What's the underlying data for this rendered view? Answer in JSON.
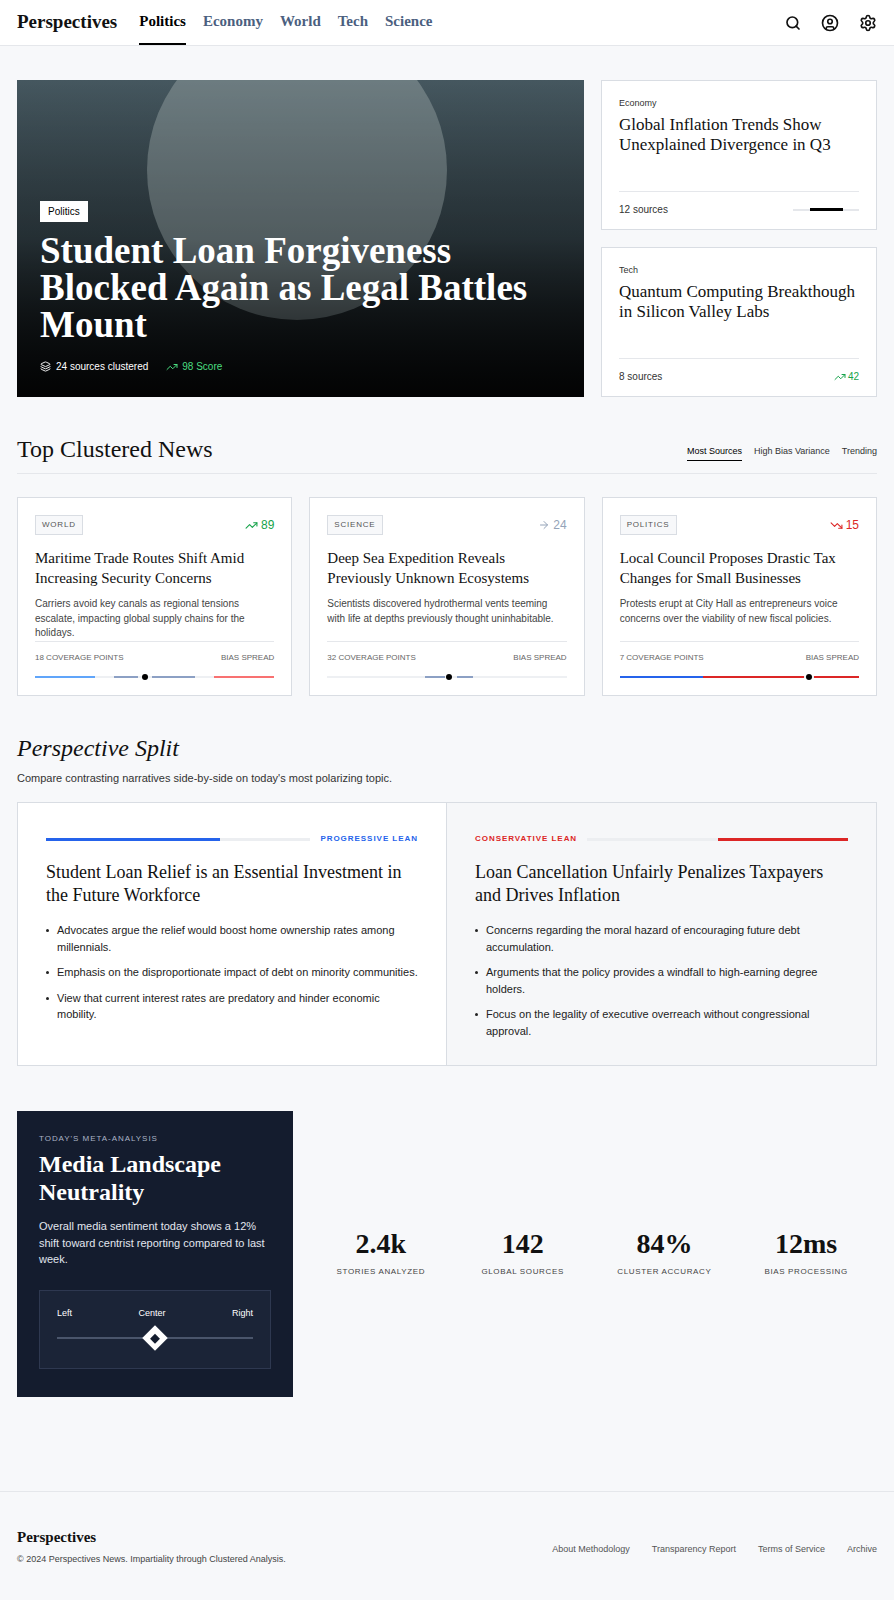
{
  "nav": {
    "logo": "Perspectives",
    "items": [
      {
        "label": "Politics",
        "selected": true
      },
      {
        "label": "Economy",
        "selected": false
      },
      {
        "label": "World",
        "selected": false
      },
      {
        "label": "Tech",
        "selected": false
      },
      {
        "label": "Science",
        "selected": false
      }
    ]
  },
  "hero": {
    "tag": "Politics",
    "title": "Student Loan Forgiveness Blocked Again as Legal Battles Mount",
    "sources": "24 sources clustered",
    "score": "98 Score"
  },
  "side_cards": [
    {
      "category": "Economy",
      "title": "Global Inflation Trends Show Unexplained Divergence in Q3",
      "sources": "12 sources",
      "kind": "spread",
      "start": 0.25,
      "end": 0.75
    },
    {
      "category": "Tech",
      "title": "Quantum Computing Breakthough in Silicon Valley Labs",
      "sources": "8 sources",
      "kind": "trend",
      "trend": "42"
    }
  ],
  "clustered": {
    "title": "Top Clustered News",
    "filters": [
      {
        "label": "Most Sources",
        "selected": true
      },
      {
        "label": "High Bias Variance",
        "selected": false
      },
      {
        "label": "Trending",
        "selected": false
      }
    ],
    "cards": [
      {
        "tag": "WORLD",
        "trend": "89",
        "direction": "up",
        "color": "#16a34a",
        "title": "Maritime Trade Routes Shift Amid Increasing Security Concerns",
        "summary": "Carriers avoid key canals as regional tensions escalate, impacting global supply chains for the holidays.",
        "coverage": "18 COVERAGE POINTS",
        "bias_label": "BIAS SPREAD",
        "marker": 0.46,
        "segments": [
          {
            "start": 0,
            "end": 0.25,
            "color": "#60a5fa"
          },
          {
            "start": 0.33,
            "end": 0.43,
            "color": "#8ca0c4"
          },
          {
            "start": 0.49,
            "end": 0.67,
            "color": "#8ca0c4"
          },
          {
            "start": 0.75,
            "end": 1,
            "color": "#f87171"
          }
        ]
      },
      {
        "tag": "SCIENCE",
        "trend": "24",
        "direction": "flat",
        "color": "#94a3b8",
        "title": "Deep Sea Expedition Reveals Previously Unknown Ecosystems",
        "summary": "Scientists discovered hydrothermal vents teeming with life at depths previously thought uninhabitable.",
        "coverage": "32 COVERAGE POINTS",
        "bias_label": "BIAS SPREAD",
        "marker": 0.51,
        "segments": [
          {
            "start": 0.41,
            "end": 0.49,
            "color": "#8ca0c4"
          },
          {
            "start": 0.54,
            "end": 0.61,
            "color": "#8ca0c4"
          }
        ]
      },
      {
        "tag": "POLITICS",
        "trend": "15",
        "direction": "down",
        "color": "#dc2626",
        "title": "Local Council Proposes Drastic Tax Changes for Small Businesses",
        "summary": "Protests erupt at City Hall as entrepreneurs voice concerns over the viability of new fiscal policies.",
        "coverage": "7 COVERAGE POINTS",
        "bias_label": "BIAS SPREAD",
        "marker": 0.79,
        "segments": [
          {
            "start": 0,
            "end": 0.35,
            "color": "#2563eb"
          },
          {
            "start": 0.35,
            "end": 0.77,
            "color": "#dc2626"
          },
          {
            "start": 0.81,
            "end": 1,
            "color": "#dc2626"
          }
        ]
      }
    ]
  },
  "split": {
    "title": "Perspective Split",
    "subtitle": "Compare contrasting narratives side-by-side on today's most polarizing topic.",
    "sides": [
      {
        "label": "PROGRESSIVE LEAN",
        "color": "#2563eb",
        "start": 0,
        "end": 0.66,
        "title": "Student Loan Relief is an Essential Investment in the Future Workforce",
        "points": [
          "Advocates argue the relief would boost home ownership rates among millennials.",
          "Emphasis on the disproportionate impact of debt on minority communities.",
          "View that current interest rates are predatory and hinder economic mobility."
        ]
      },
      {
        "label": "CONSERVATIVE LEAN",
        "color": "#dc2626",
        "start": 0.5,
        "end": 1,
        "title": "Loan Cancellation Unfairly Penalizes Taxpayers and Drives Inflation",
        "points": [
          "Concerns regarding the moral hazard of encouraging future debt accumulation.",
          "Arguments that the policy provides a windfall to high-earning degree holders.",
          "Focus on the legality of executive overreach without congressional approval."
        ]
      }
    ]
  },
  "meta": {
    "eyebrow": "TODAY'S META-ANALYSIS",
    "title": "Media Landscape Neutrality",
    "text": "Overall media sentiment today shows a 12% shift toward centrist reporting compared to last week.",
    "scale": [
      "Left",
      "Center",
      "Right"
    ],
    "level": 0.5
  },
  "stats": [
    {
      "value": "2.4k",
      "label": "STORIES ANALYZED"
    },
    {
      "value": "142",
      "label": "GLOBAL SOURCES"
    },
    {
      "value": "84%",
      "label": "CLUSTER ACCURACY"
    },
    {
      "value": "12ms",
      "label": "BIAS PROCESSING"
    }
  ],
  "footer": {
    "logo": "Perspectives",
    "copyright": "© 2024 Perspectives News. Impartiality through Clustered Analysis.",
    "links": [
      "About Methodology",
      "Transparency Report",
      "Terms of Service",
      "Archive"
    ]
  }
}
